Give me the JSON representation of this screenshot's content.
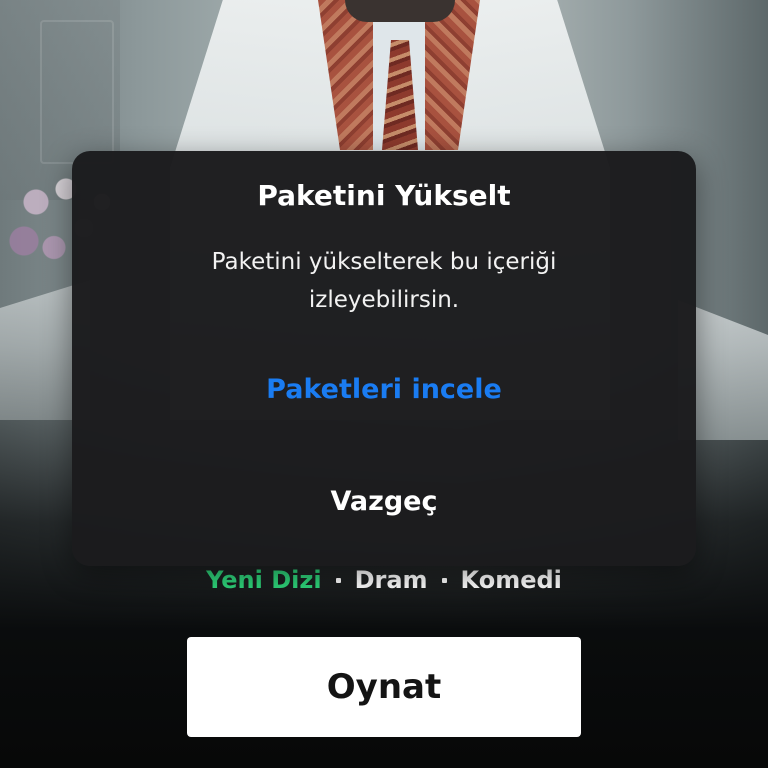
{
  "dialog": {
    "title": "Paketini Yükselt",
    "message": "Paketini yükselterek bu içeriği izleyebilirsin.",
    "primary_action": "Paketleri incele",
    "cancel_action": "Vazgeç"
  },
  "genres": {
    "badge": "Yeni Dizi",
    "items": [
      "Dram",
      "Komedi"
    ]
  },
  "play_button": {
    "label": "Oynat"
  },
  "colors": {
    "accent_blue": "#1a7cf2",
    "new_series_green": "#2ed47a",
    "dialog_bg": "#1c1c1e"
  }
}
